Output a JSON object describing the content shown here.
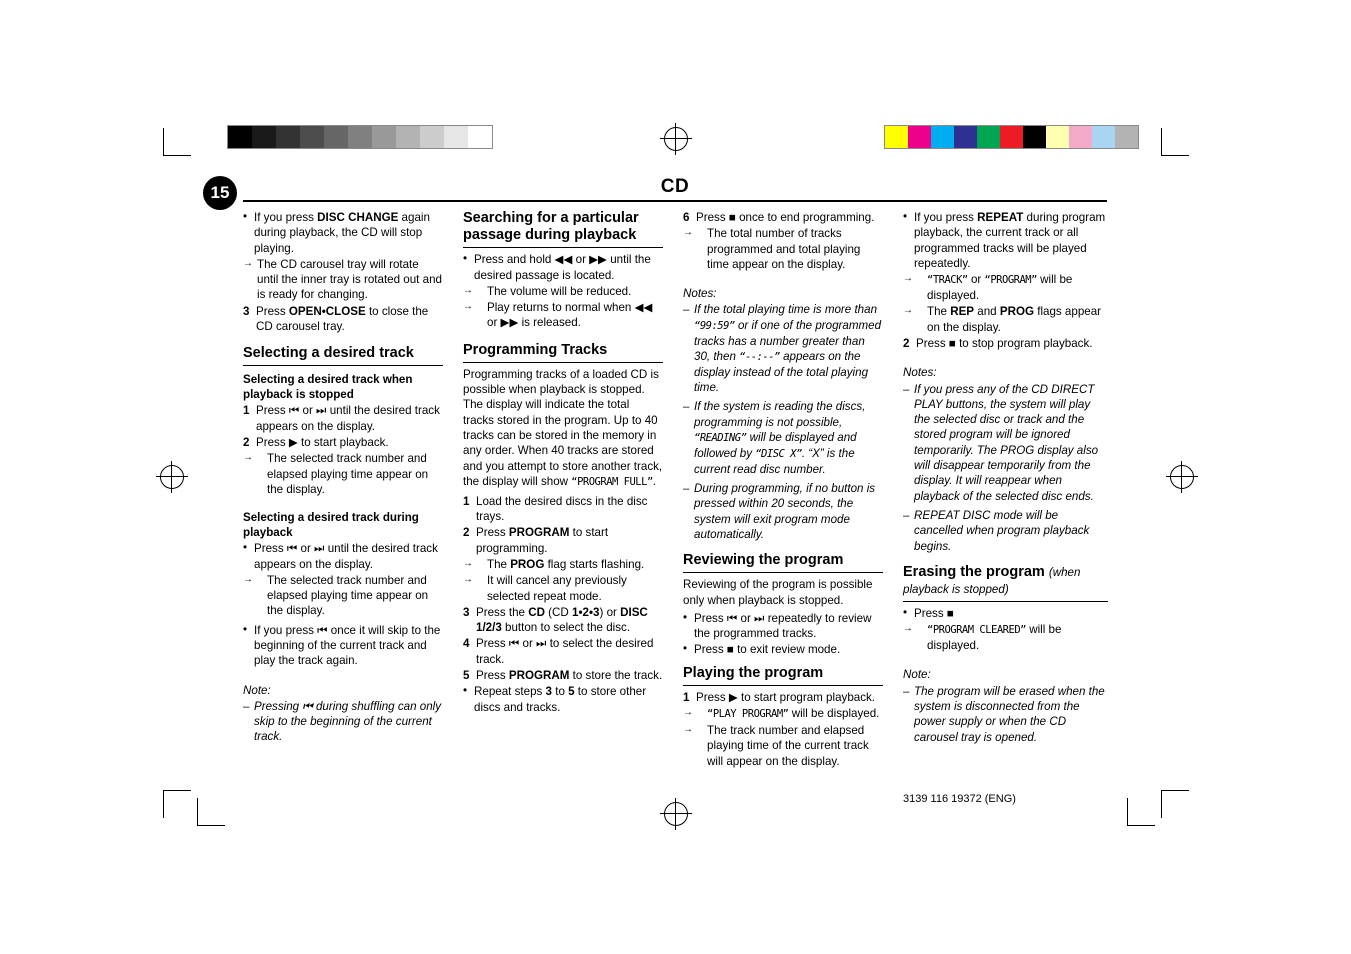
{
  "header": {
    "title": "CD",
    "page_number": "15"
  },
  "footer": {
    "code": "3139 116 19372 (ENG)"
  },
  "colorbar_left": [
    "#000000",
    "#1a1a1a",
    "#333333",
    "#4d4d4d",
    "#666666",
    "#808080",
    "#999999",
    "#b3b3b3",
    "#cccccc",
    "#e6e6e6",
    "#ffffff"
  ],
  "colorbar_right": [
    "#ffff00",
    "#ec008c",
    "#00aeef",
    "#2e3192",
    "#00a651",
    "#ed1c24",
    "#000000",
    "#ffffb0",
    "#f5a9c8",
    "#a7d5f2",
    "#b3b3b3"
  ],
  "col1": {
    "b1": "If you press DISC CHANGE again during playback, the CD will stop playing.",
    "b1a": "The CD carousel tray will rotate until the inner tray is rotated out and is ready for changing.",
    "n3": "Press OPEN•CLOSE to close the CD carousel tray.",
    "h_select": "Selecting a desired track",
    "h_stopped": "Selecting a desired track when playback is stopped",
    "s1": "Press ⏮ or ⏭ until the desired track appears on the display.",
    "s2": "Press ▶ to start playback.",
    "s2a": "The selected track number and elapsed playing time appear on the display.",
    "h_during": "Selecting a desired track during playback",
    "d1": "Press ⏮ or ⏭ until the desired track appears on the display.",
    "d1a": "The selected track number and elapsed playing time appear on the display.",
    "d2": "If you press ⏮ once it will skip to the beginning of the current track and play the track again.",
    "noteword": "Note:",
    "note1": "Pressing ⏮ during shuffling can only skip to the beginning of the current track."
  },
  "col2": {
    "h_search": "Searching for a particular passage during playback",
    "s1": "Press and hold ◀◀ or ▶▶ until the desired passage is located.",
    "s1a": "The volume will be reduced.",
    "s1b": "Play returns to normal when ◀◀ or ▶▶ is released.",
    "h_prog": "Programming Tracks",
    "p_intro": "Programming tracks of a loaded CD is possible when playback is stopped. The display will indicate the total tracks stored in the program. Up to 40 tracks can be stored in the memory in any order. When 40 tracks are stored and you attempt to store another track, the display will show “PROGRAM FULL”.",
    "n1": "Load the desired discs in the disc trays.",
    "n2": "Press PROGRAM to start programming.",
    "n2a": "The PROG flag starts flashing.",
    "n2b": "It will cancel any previously selected repeat mode.",
    "n3": "Press the CD (CD 1•2•3) or DISC 1/2/3 button to select the disc.",
    "n4": "Press ⏮ or ⏭ to select the desired track.",
    "n5": "Press PROGRAM to store the track.",
    "b_repeat": "Repeat steps 3 to 5 to store other discs and tracks."
  },
  "col3": {
    "n6": "Press ■ once to end programming.",
    "n6a": "The total number of tracks programmed and total playing time appear on the display.",
    "noteshead": "Notes:",
    "note1": "If the total playing time is more than “99:59” or if one of the programmed tracks has a number greater than 30, then “--:--” appears on the display instead of the total playing time.",
    "note2": "If the system is reading the discs, programming is not possible, “READING” will be displayed and followed by “DISC X”. “X” is the current read disc number.",
    "note3": "During programming, if no button is pressed within 20 seconds, the system will exit program mode automatically.",
    "h_review": "Reviewing the program",
    "r_intro": "Reviewing of the program is possible only when playback is stopped.",
    "r1": "Press ⏮ or ⏭ repeatedly to review the programmed tracks.",
    "r2": "Press ■ to exit review mode.",
    "h_play": "Playing the program",
    "p1": "Press ▶ to start program playback.",
    "p1a": "“PLAY PROGRAM” will be displayed.",
    "p1b": "The track number and elapsed playing time of the current track will appear on the display."
  },
  "col4": {
    "b1": "If you press REPEAT during program playback, the current track or all programmed tracks will be played repeatedly.",
    "b1a": "“TRACK” or “PROGRAM” will be displayed.",
    "b1b": "The REP and PROG flags appear on the display.",
    "n2": "Press ■ to stop program playback.",
    "noteshead": "Notes:",
    "note1": "If you press any of the CD DIRECT PLAY buttons, the system will play the selected disc or track and the stored program will be ignored temporarily. The PROG display also will disappear temporarily from the display. It will reappear when playback of the selected disc ends.",
    "note2": "REPEAT DISC mode will be cancelled when program playback begins.",
    "h_erase": "Erasing the program",
    "h_erase_sub": "(when playback is stopped)",
    "e1": "Press ■",
    "e1a": "“PROGRAM CLEARED” will be displayed.",
    "noteword": "Note:",
    "note3": "The program will be erased when the system is disconnected from the power supply or when the CD carousel tray is opened."
  }
}
